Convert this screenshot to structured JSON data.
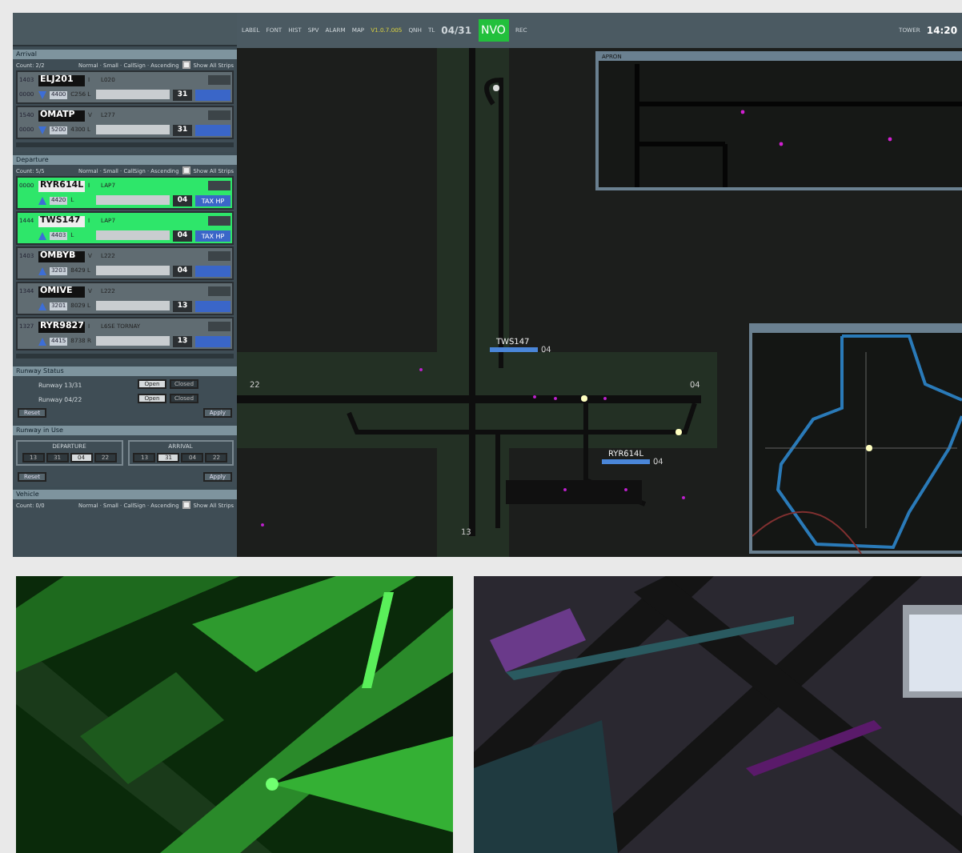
{
  "toolbar": {
    "items": [
      "LABEL",
      "FONT",
      "HIST",
      "SPV",
      "ALARM"
    ],
    "map_label": "MAP",
    "map_version": "V1.0.7.005",
    "qnh": "QNH",
    "tl": "TL",
    "runways": "04/31",
    "mode": "NVO",
    "rec": "REC",
    "position": "TOWER",
    "time": "14:20"
  },
  "panels": [
    {
      "kind": "arrival",
      "title": "Arrival",
      "count": "Count: 2/2",
      "sort": "Normal · Small · CallSign · Ascending",
      "show_all": "Show All Strips",
      "show_all_checked": true,
      "strips": [
        {
          "time": "1403",
          "callsign": "ELJ201",
          "rule": "I",
          "route": "L020",
          "sub": "0000",
          "squawk": "4400",
          "type": "C256 L",
          "runway": "31",
          "highlighted": false
        },
        {
          "time": "1540",
          "callsign": "OMATP",
          "rule": "V",
          "route": "L277",
          "sub": "0000",
          "squawk": "5200",
          "type": "4300 L",
          "runway": "31",
          "highlighted": false
        }
      ]
    },
    {
      "kind": "departure",
      "title": "Departure",
      "count": "Count: 5/5",
      "sort": "Normal · Small · CallSign · Ascending",
      "show_all": "Show All Strips",
      "show_all_checked": true,
      "strips": [
        {
          "time": "0000",
          "callsign": "RYR614L",
          "rule": "I",
          "route": "LAP7",
          "squawk": "4420",
          "type": "L",
          "runway": "04",
          "status": "TAX HP",
          "highlighted": true
        },
        {
          "time": "1444",
          "callsign": "TWS147",
          "rule": "I",
          "route": "LAP7",
          "squawk": "4403",
          "type": "L",
          "runway": "04",
          "status": "TAX HP",
          "highlighted": true
        },
        {
          "time": "1403",
          "callsign": "OMBYB",
          "rule": "V",
          "route": "L222",
          "squawk": "3203",
          "type": "8429 L",
          "runway": "04",
          "highlighted": false
        },
        {
          "time": "1344",
          "callsign": "OMIVE",
          "rule": "V",
          "route": "L222",
          "squawk": "3201",
          "type": "8029 L",
          "runway": "13",
          "highlighted": false
        },
        {
          "time": "1327",
          "callsign": "RYR9827",
          "rule": "I",
          "route": "L6SE TORNAY",
          "squawk": "4415",
          "type": "8738 R",
          "runway": "13",
          "highlighted": false
        }
      ]
    }
  ],
  "runway_status": {
    "title": "Runway Status",
    "rows": [
      {
        "name": "Runway 13/31",
        "options": [
          {
            "label": "Open",
            "selected": true
          },
          {
            "label": "Closed",
            "selected": false
          }
        ]
      },
      {
        "name": "Runway 04/22",
        "options": [
          {
            "label": "Open",
            "selected": true
          },
          {
            "label": "Closed",
            "selected": false
          }
        ]
      }
    ],
    "reset": "Reset",
    "apply": "Apply"
  },
  "runway_in_use": {
    "title": "Runway in Use",
    "groups": [
      {
        "title": "DEPARTURE",
        "options": [
          {
            "label": "13",
            "selected": false
          },
          {
            "label": "31",
            "selected": false
          },
          {
            "label": "04",
            "selected": true
          },
          {
            "label": "22",
            "selected": false
          }
        ]
      },
      {
        "title": "ARRIVAL",
        "options": [
          {
            "label": "13",
            "selected": false
          },
          {
            "label": "31",
            "selected": true
          },
          {
            "label": "04",
            "selected": false
          },
          {
            "label": "22",
            "selected": false
          }
        ]
      }
    ],
    "reset": "Reset",
    "apply": "Apply"
  },
  "vehicle": {
    "title": "Vehicle",
    "count": "Count: 0/0",
    "sort": "Normal · Small · CallSign · Ascending",
    "show_all": "Show All Strips",
    "show_all_checked": true
  },
  "map": {
    "runway_labels": [
      "22",
      "04",
      "13"
    ],
    "aircraft": [
      {
        "callsign": "TWS147",
        "runway": "04"
      },
      {
        "callsign": "RYR614L",
        "runway": "04"
      }
    ],
    "inset_title": "APRON"
  }
}
